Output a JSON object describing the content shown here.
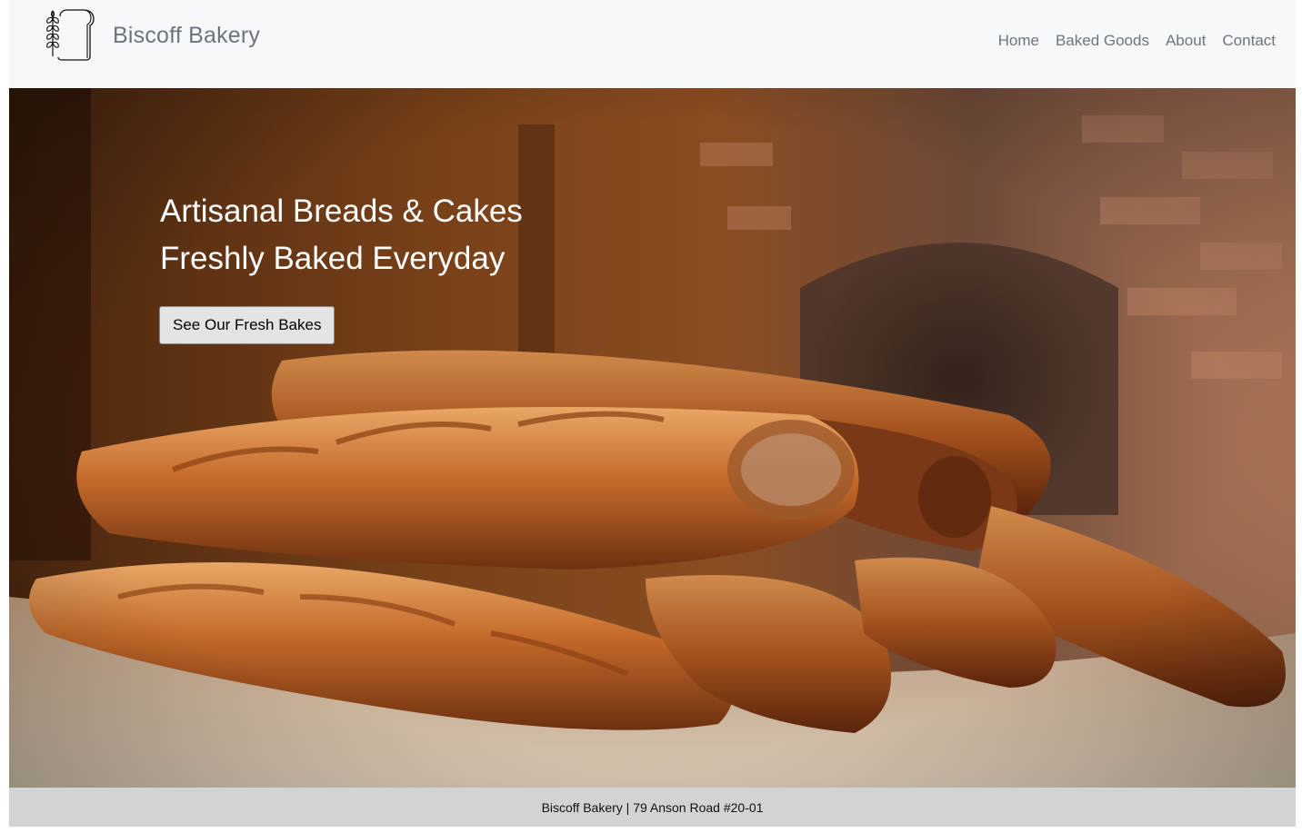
{
  "brand": {
    "name": "Biscoff Bakery",
    "logo_icon": "wheat-bread-icon"
  },
  "nav": {
    "items": [
      {
        "label": "Home"
      },
      {
        "label": "Baked Goods"
      },
      {
        "label": "About"
      },
      {
        "label": "Contact"
      }
    ]
  },
  "hero": {
    "heading_line1": "Artisanal Breads & Cakes",
    "heading_line2": "Freshly Baked Everyday",
    "button_label": "See Our Fresh Bakes"
  },
  "footer": {
    "text": "Biscoff Bakery | 79 Anson Road #20-01"
  },
  "colors": {
    "navbar_bg": "#f7f8f9",
    "nav_text": "#6c757d",
    "footer_bg": "#d3d3d3",
    "hero_text": "#ffffff"
  }
}
